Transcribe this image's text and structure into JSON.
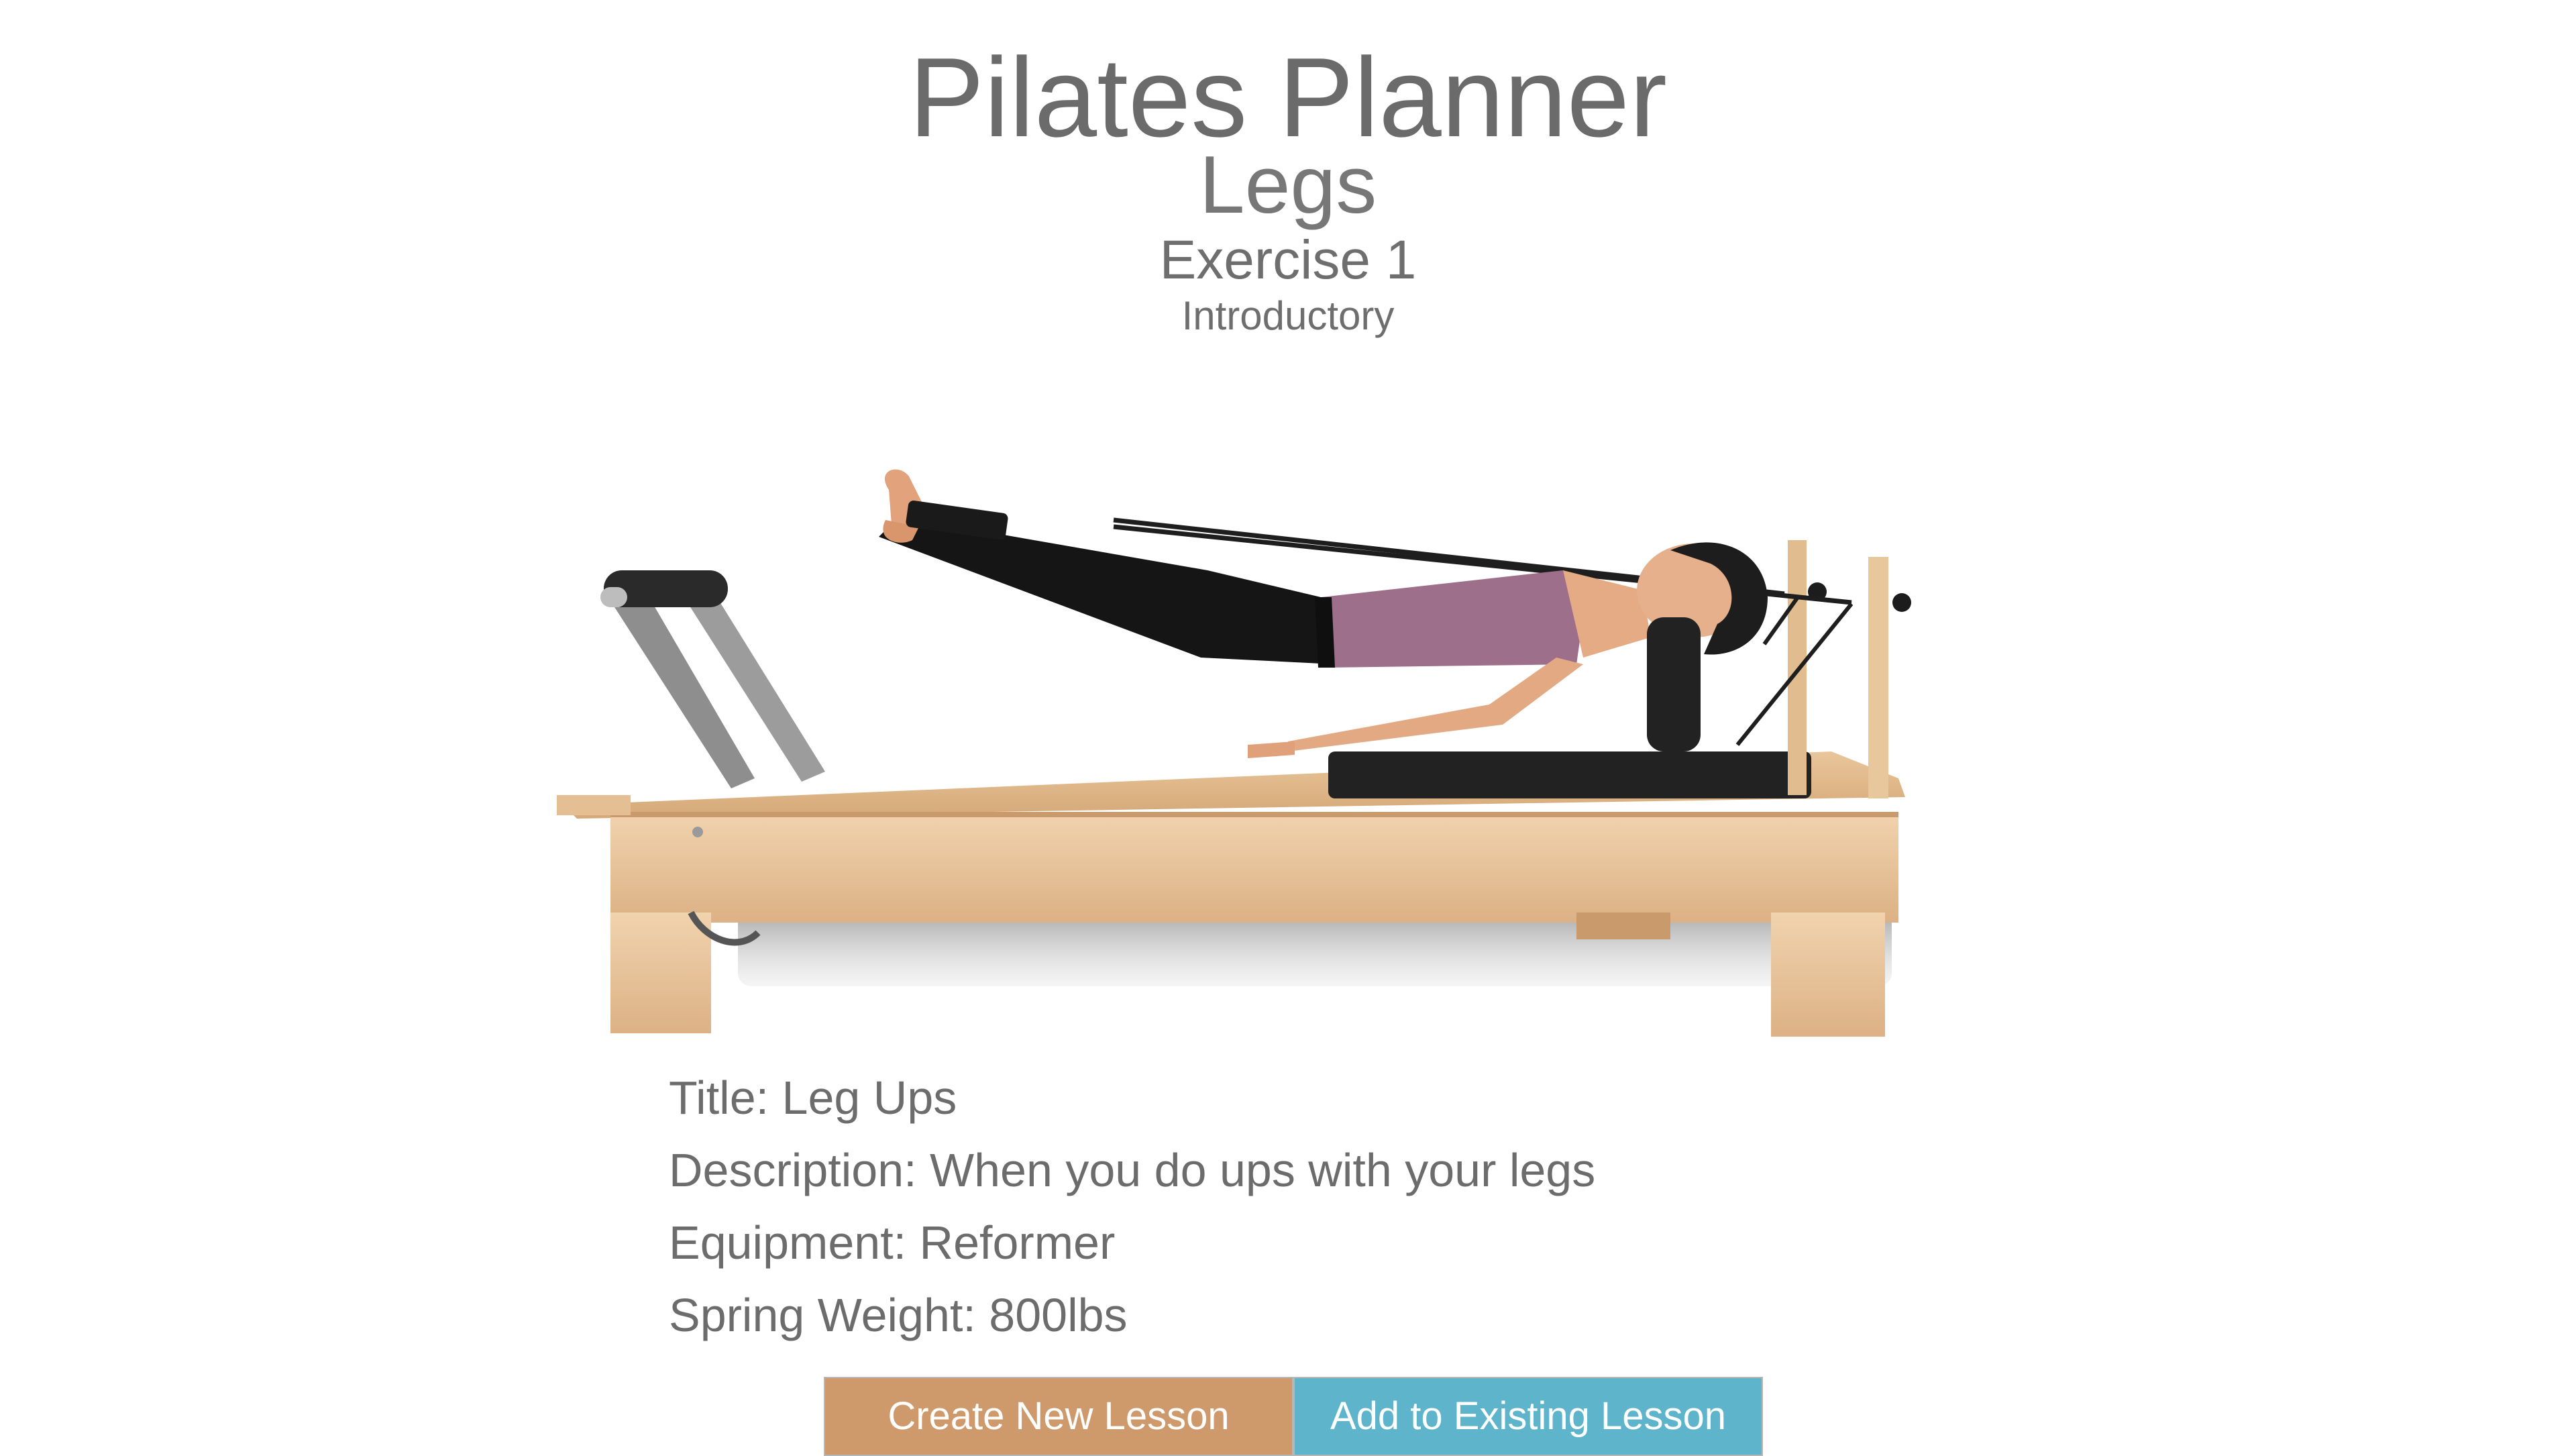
{
  "header": {
    "title": "Pilates Planner",
    "category": "Legs",
    "exercise": "Exercise 1",
    "level": "Introductory"
  },
  "details": {
    "title": "Title: Leg Ups",
    "description": "Description: When you do ups with your legs",
    "equipment": "Equipment: Reformer",
    "spring_weight": "Spring Weight: 800lbs"
  },
  "buttons": {
    "create_label": "Create New Lesson",
    "add_label": "Add to Existing Lesson"
  },
  "colors": {
    "create_button_bg": "#cf9a6b",
    "add_button_bg": "#5eb4cb"
  },
  "photo": {
    "subject": "woman-on-pilates-reformer-icon"
  }
}
